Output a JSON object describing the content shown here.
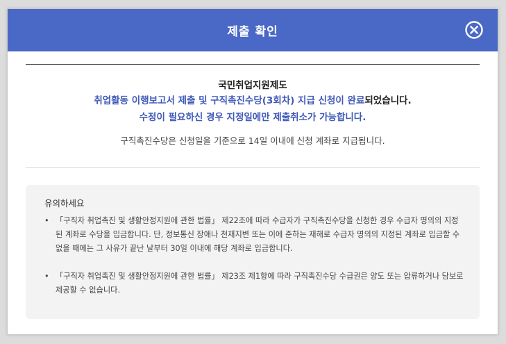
{
  "dialog": {
    "title": "제출 확인",
    "close_icon": "close-circle-icon"
  },
  "message": {
    "org": "국민취업지원제도",
    "line1_prefix": "취업활동 이행보고서 제출 및 구직촉진수당(3회차) 지급 신청이 완료",
    "line1_suffix": "되었습니다.",
    "line2": "수정이 필요하신 경우 지정일에만 제출취소가 가능합니다.",
    "note": "구직촉진수당은 신청일을 기준으로 14일 이내에 신청 계좌로 지급됩니다."
  },
  "caution": {
    "title": "유의하세요",
    "items": [
      "「구직자 취업촉진 및 생활안정지원에 관한 법률」 제22조에 따라 수급자가 구직촉진수당을 신청한 경우 수급자 명의의 지정된 계좌로 수당을 입금합니다. 단, 정보통신 장애나 천재지변 또는 이에 준하는 재해로 수급자 명의의 지정된 계좌로 입금할 수 없을 때에는 그 사유가 끝난 날부터 30일 이내에 해당 계좌로 입금합니다.",
      "「구직자 취업촉진 및 생활안정지원에 관한 법률」 제23조 제1항에 따라 구직촉진수당 수급권은 양도 또는 압류하거나 담보로 제공할 수 없습니다."
    ]
  },
  "colors": {
    "header_bg": "#4a68c6",
    "accent_text": "#3f59b8",
    "caution_bg": "#f3f3f3"
  }
}
